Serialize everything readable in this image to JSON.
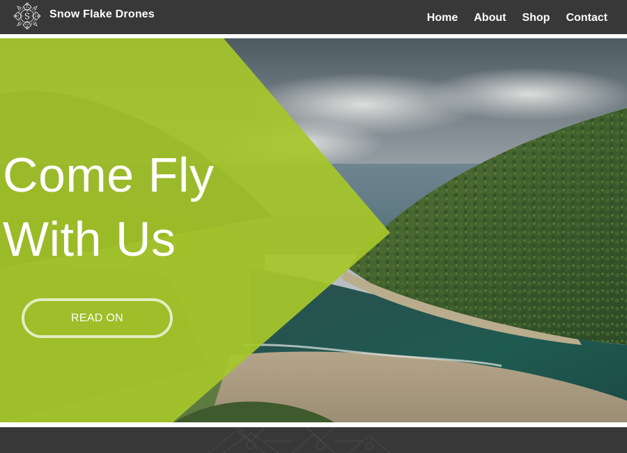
{
  "header": {
    "site_title": "Snow Flake Drones",
    "logo_letter": "S",
    "logo_icon": "ornamental-snowflake-frame",
    "nav": [
      {
        "label": "Home"
      },
      {
        "label": "About"
      },
      {
        "label": "Shop"
      },
      {
        "label": "Contact"
      }
    ]
  },
  "hero": {
    "headline_line1": "Come Fly",
    "headline_line2": "With Us",
    "cta_label": "READ ON",
    "background": "aerial-coast-river-photo",
    "overlay_color": "#a6c62a"
  },
  "colors": {
    "header_bg": "#383838",
    "divider": "#ffffff",
    "accent_green": "#a6c62a",
    "footer_bg": "#383838"
  },
  "footer": {
    "decoration": "snowflake-pattern"
  }
}
